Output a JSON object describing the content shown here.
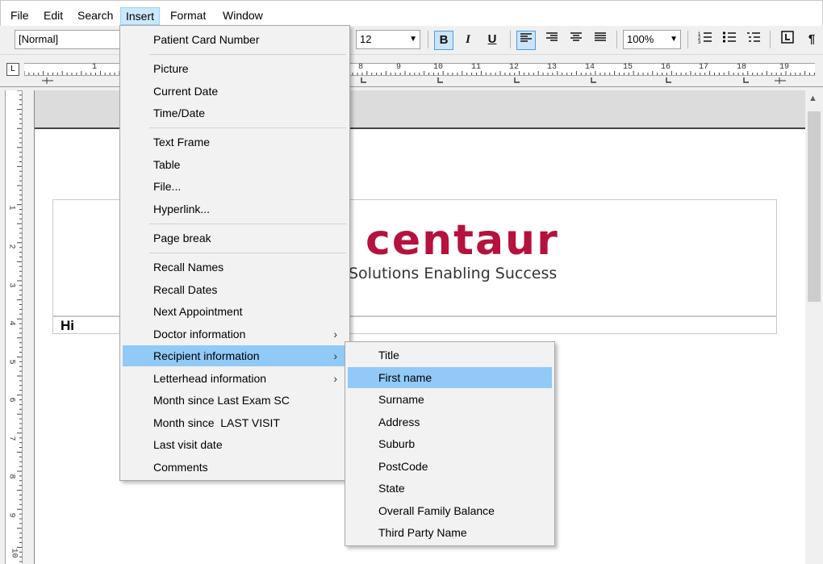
{
  "menubar": {
    "file": "File",
    "edit": "Edit",
    "search": "Search",
    "insert": "Insert",
    "format": "Format",
    "window": "Window"
  },
  "toolbar": {
    "style": "[Normal]",
    "font_size": "12",
    "bold": "B",
    "italic": "I",
    "underline": "U",
    "zoom": "100%",
    "pilcrow": "¶"
  },
  "ruler": {
    "h_numbers": [
      "1",
      "8",
      "9",
      "10",
      "11",
      "12",
      "13",
      "14",
      "15",
      "16",
      "17",
      "18",
      "19"
    ],
    "v_numbers": [
      "1",
      "2",
      "3",
      "4",
      "5",
      "6",
      "7",
      "8",
      "9",
      "10"
    ]
  },
  "document": {
    "logo": "centaur",
    "tagline": "Solutions Enabling Success",
    "greeting": "Hi"
  },
  "insert_menu": {
    "items": [
      "Patient Card Number",
      "Picture",
      "Current Date",
      "Time/Date",
      "Text Frame",
      "Table",
      "File...",
      "Hyperlink...",
      "Page break",
      "Recall Names",
      "Recall Dates",
      "Next Appointment",
      "Doctor information",
      "Recipient information",
      "Letterhead information",
      "Month since Last Exam SC",
      "Month since  LAST VISIT",
      "Last visit date",
      "Comments"
    ]
  },
  "recipient_menu": {
    "items": [
      "Title",
      "First name",
      "Surname",
      "Address",
      "Suburb",
      "PostCode",
      "State",
      "Overall Family Balance",
      "Third Party Name"
    ]
  },
  "colors": {
    "highlight": "#91c9f7",
    "logo": "#b5123e",
    "menu_active": "#cce8ff"
  }
}
